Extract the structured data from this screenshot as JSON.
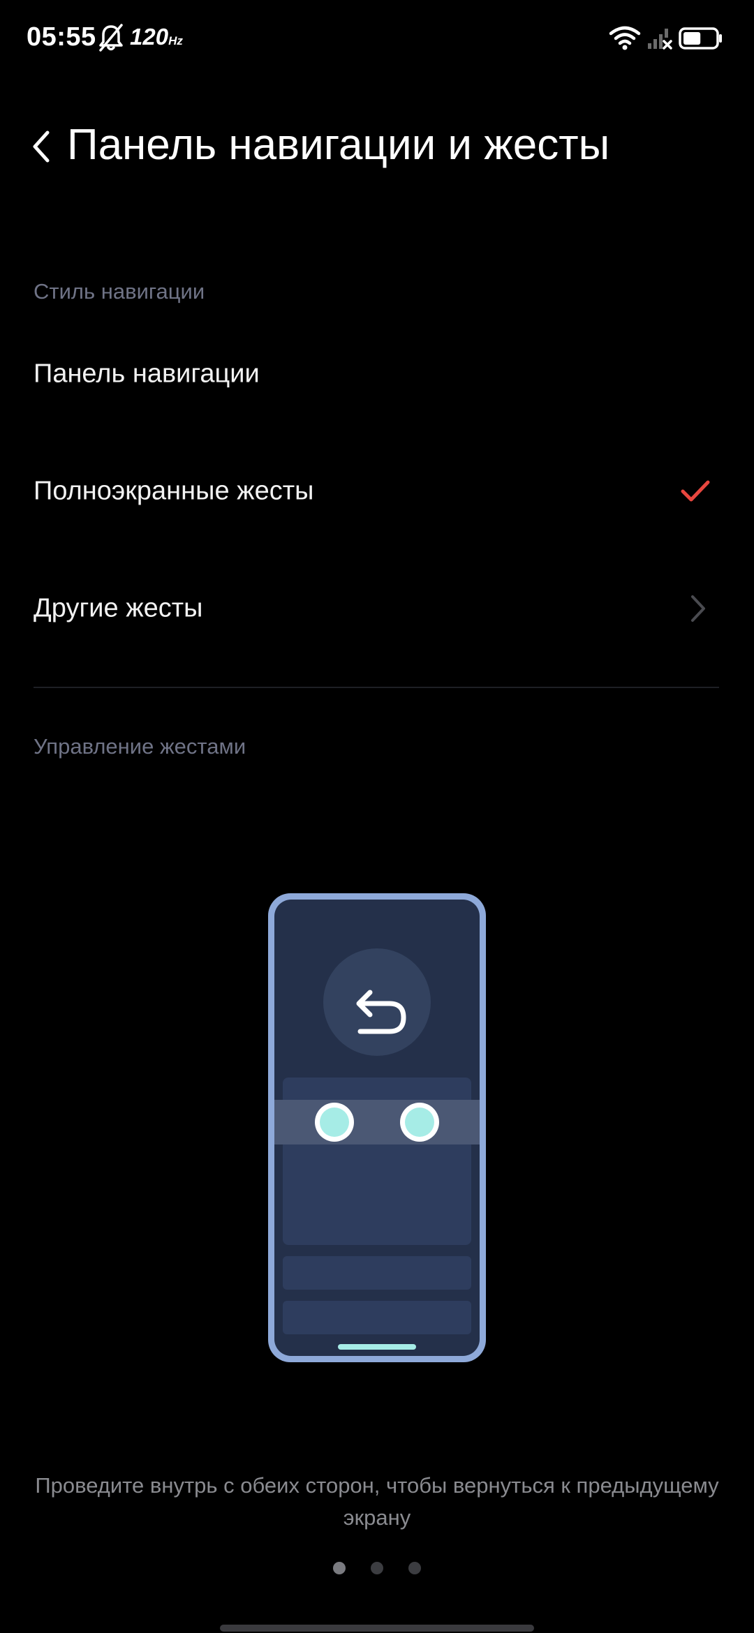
{
  "status_bar": {
    "time": "05:55",
    "refresh_rate": "120",
    "refresh_unit": "Hz",
    "icons": [
      "bell-off-icon",
      "wifi-icon",
      "signal-no-service-icon",
      "battery-icon"
    ],
    "battery_level": 0.55
  },
  "header": {
    "title": "Панель навигации и жесты",
    "back_icon": "chevron-left-icon"
  },
  "navigation_style": {
    "section_label": "Стиль навигации",
    "items": [
      {
        "label": "Панель навигации",
        "selected": false
      },
      {
        "label": "Полноэкранные жесты",
        "selected": true,
        "indicator": "check-icon"
      },
      {
        "label": "Другие жесты",
        "indicator": "chevron-right-icon"
      }
    ]
  },
  "gesture_control": {
    "section_label": "Управление жестами",
    "illustration_icon": "back-arrow-icon",
    "caption": "Проведите внутрь с обеих сторон, чтобы вернуться к предыдущему экрану",
    "page_count": 3,
    "current_page": 1
  },
  "colors": {
    "accent_check": "#e8473f",
    "phone_frame": "#8ea9d9",
    "phone_screen": "#24304a",
    "touch_point": "#a6ece6"
  }
}
